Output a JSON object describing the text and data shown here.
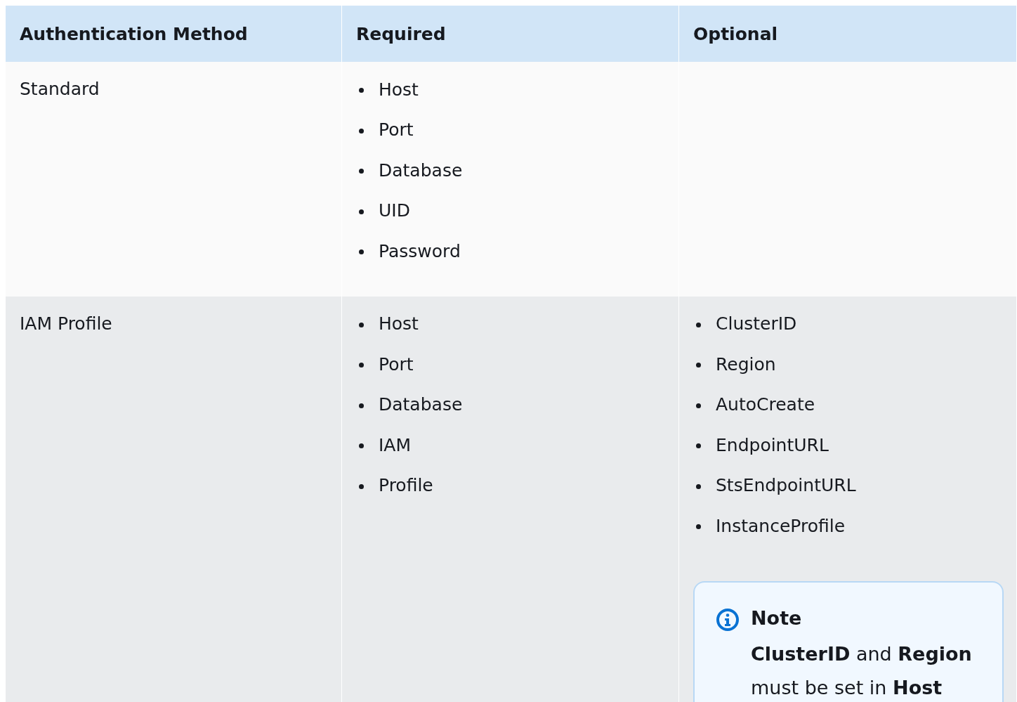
{
  "table": {
    "columns": [
      "Authentication Method",
      "Required",
      "Optional"
    ],
    "rows": [
      {
        "method": "Standard",
        "required": [
          "Host",
          "Port",
          "Database",
          "UID",
          "Password"
        ],
        "optional": []
      },
      {
        "method": "IAM Profile",
        "required": [
          "Host",
          "Port",
          "Database",
          "IAM",
          "Profile"
        ],
        "optional": [
          "ClusterID",
          "Region",
          "AutoCreate",
          "EndpointURL",
          "StsEndpointURL",
          "InstanceProfile"
        ],
        "note": {
          "title": "Note",
          "text": "**ClusterID** and **Region** must be set in **Host**"
        }
      }
    ]
  }
}
